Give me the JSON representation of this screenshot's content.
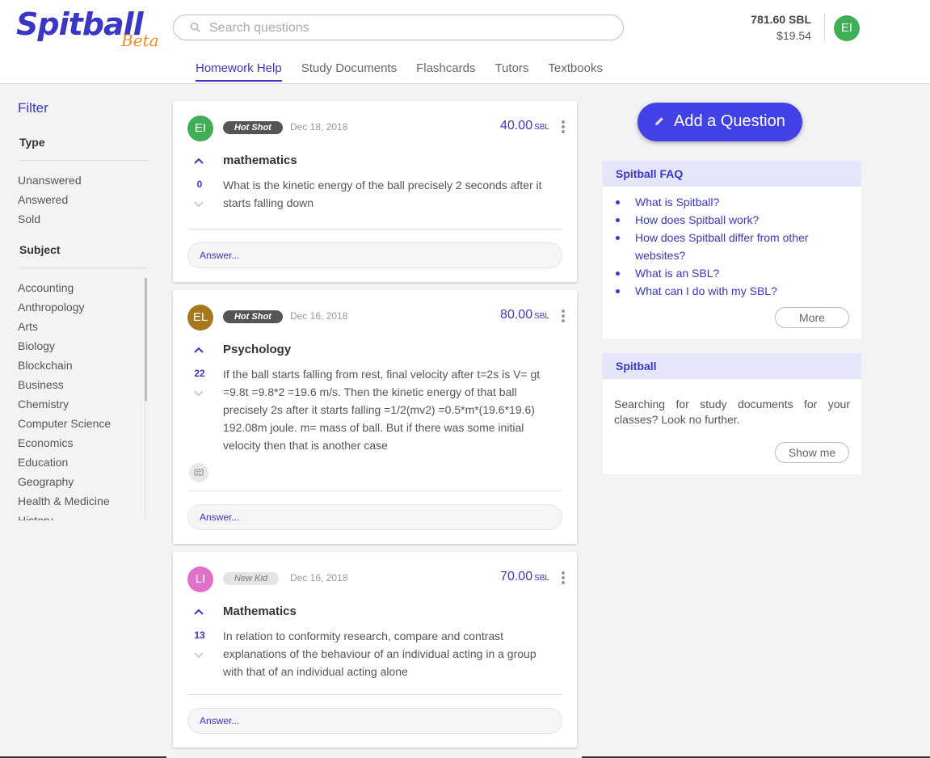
{
  "brand": {
    "name": "Spitball",
    "tag": "Beta"
  },
  "search": {
    "placeholder": "Search questions"
  },
  "account": {
    "sbl_balance": "781.60 SBL",
    "usd_balance": "$19.54",
    "initials": "EI"
  },
  "nav": [
    {
      "label": "Homework Help",
      "active": true
    },
    {
      "label": "Study Documents"
    },
    {
      "label": "Flashcards"
    },
    {
      "label": "Tutors"
    },
    {
      "label": "Textbooks"
    }
  ],
  "filter": {
    "title": "Filter",
    "type_title": "Type",
    "types": [
      "Unanswered",
      "Answered",
      "Sold"
    ],
    "subject_title": "Subject",
    "subjects": [
      "Accounting",
      "Anthropology",
      "Arts",
      "Biology",
      "Blockchain",
      "Business",
      "Chemistry",
      "Computer Science",
      "Economics",
      "Education",
      "Geography",
      "Health & Medicine",
      "History"
    ]
  },
  "questions": [
    {
      "initials": "EI",
      "avatar_color": "#3fae56",
      "badge": "Hot Shot",
      "date": "Dec 18, 2018",
      "price": "40.00",
      "unit": "SBL",
      "votes": "0",
      "subject": "mathematics",
      "text": "What is the kinetic energy of the ball precisely 2 seconds after it starts falling down",
      "answer_placeholder": "Answer..."
    },
    {
      "initials": "EL",
      "avatar_color": "#a6781e",
      "badge": "Hot Shot",
      "date": "Dec 16, 2018",
      "price": "80.00",
      "unit": "SBL",
      "votes": "22",
      "subject": "Psychology",
      "text": "If the ball starts falling from rest, final velocity after t=2s is V= gt =9.8t =9.8*2 =19.6 m/s.  Then the kinetic energy of that ball precisely 2s after it starts falling =1/2(mv2) =0.5*m*(19.6*19.6) 192.08m joule. m= mass of ball. But if there was some initial velocity then that is another case",
      "answer_placeholder": "Answer..."
    },
    {
      "initials": "LI",
      "avatar_color": "#e070c8",
      "badge": "New Kid",
      "date": "Dec 16, 2018",
      "price": "70.00",
      "unit": "SBL",
      "votes": "13",
      "subject": "Mathematics",
      "text": "In relation to conformity research, compare and contrast explanations of the behaviour of an individual acting  in a group with that of an individual acting alone",
      "answer_placeholder": "Answer..."
    }
  ],
  "sidebar": {
    "add_question": "Add a Question",
    "faq_title": "Spitball FAQ",
    "faq": [
      "What is Spitball?",
      "How does Spitball work?",
      "How does Spitball differ from other websites?",
      "What is an SBL?",
      "What can I do with my SBL?"
    ],
    "faq_more": "More",
    "promo_title": "Spitball",
    "promo_text": "Searching for study documents for your classes? Look no further.",
    "promo_button": "Show me"
  }
}
